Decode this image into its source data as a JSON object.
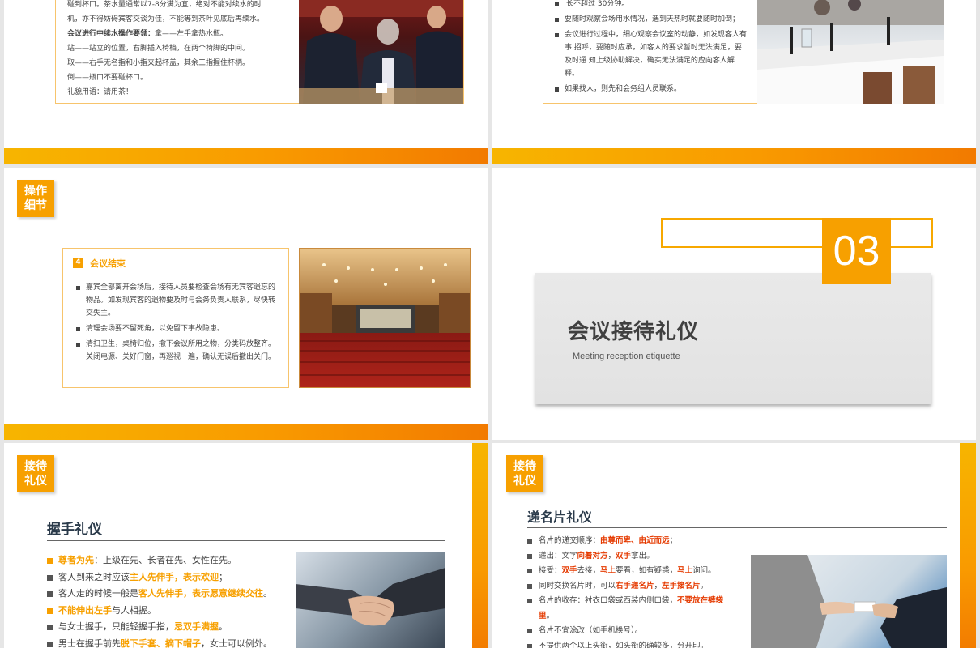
{
  "slide1": {
    "lines": [
      "碰到杯口。茶水量通常以7-8分满为宜，绝对不能对续水的时",
      "机，亦不得妨碍宾客交谈为佳，不能等到茶叶见底后再续水。"
    ],
    "sub_heading": "会议进行中续水操作要领：",
    "sub_heading_tail": "拿——左手拿热水瓶。",
    "steps": [
      "站——站立的位置，右脚插入椅档，在两个椅脚的中间。",
      "取——右手无名指和小指夹起杯盖，其余三指握住杯柄。",
      "倒——瓶口不要碰杯口。",
      "礼貌用语：请用茶！"
    ]
  },
  "slide2": {
    "line0": "长不超过 30分钟。",
    "bullets": [
      "要随时观察会场用水情况，遇到天热时就要随时加倒；",
      "会议进行过程中，细心观察会议室的动静，如发现客人有事 招呼，要随时应承，如客人的要求暂时无法满足，要及时通 知上级协助解决，确实无法满足的应向客人解释。",
      "如果找人，则先和会务组人员联系。"
    ]
  },
  "slide3": {
    "tag": [
      "操作",
      "细节"
    ],
    "card_num": "4",
    "card_title": "会议结束",
    "bullets": [
      "嘉宾全部离开会场后，接待人员要检查会场有无宾客遗忘的物品。如发现宾客的遗物要及时与会务负责人联系，尽快转交失主。",
      "清理会场要不留死角，以免留下事故隐患。",
      "清扫卫生，桌椅归位，撤下会议所用之物，分类码放整齐。关闭电源、关好门窗，再巡视一遍，确认无误后撤出关门。"
    ]
  },
  "slide4": {
    "number": "03",
    "title": "会议接待礼仪",
    "subtitle": "Meeting reception etiquette"
  },
  "slide5": {
    "tag": [
      "接待",
      "礼仪"
    ],
    "heading": "握手礼仪",
    "items": [
      {
        "o": "尊者为先",
        "n": "：上级在先、长者在先、女性在先。"
      },
      {
        "n": "客人到来之时应该",
        "r": "主人先伸手，表示欢迎",
        "t": "；"
      },
      {
        "n": "客人走的时候一般是",
        "r": "客人先伸手，表示愿意继续交往",
        "t": "。"
      },
      {
        "o": "不能伸出左手",
        "n": "与人相握。"
      },
      {
        "n": "与女士握手，只能轻握手指，",
        "r": "忌双手满握",
        "t": "。"
      },
      {
        "n": "男士在握手前先",
        "r": "脱下手套、摘下帽子",
        "t": "，女士可以例外。"
      }
    ]
  },
  "slide6": {
    "tag": [
      "接待",
      "礼仪"
    ],
    "heading": "递名片礼仪",
    "items": [
      {
        "n": "名片的递交顺序：",
        "r": "由尊而卑、由近而远",
        "t": "；"
      },
      {
        "n": "递出：文字",
        "r": "向着对方",
        "m": "，",
        "r2": "双手",
        "t": "拿出。"
      },
      {
        "n": "接受：",
        "r": "双手",
        "m": "去接，",
        "r2": "马上",
        "t": "要看，如有疑惑，",
        "r3": "马上",
        "t2": "询问。"
      },
      {
        "n": "同时交换名片时，可以",
        "r": "右手递名片",
        "m": "，",
        "r2": "左手接名片",
        "t": "。"
      },
      {
        "n": "名片的收存：衬衣口袋或西装内侧口袋，",
        "r": "不要放在裤袋里",
        "t": "。"
      },
      {
        "n": "名片不宜涂改（如手机换号）。"
      },
      {
        "n": "不提供两个以上头衔，如头衔的确较多，分开印。"
      }
    ]
  }
}
